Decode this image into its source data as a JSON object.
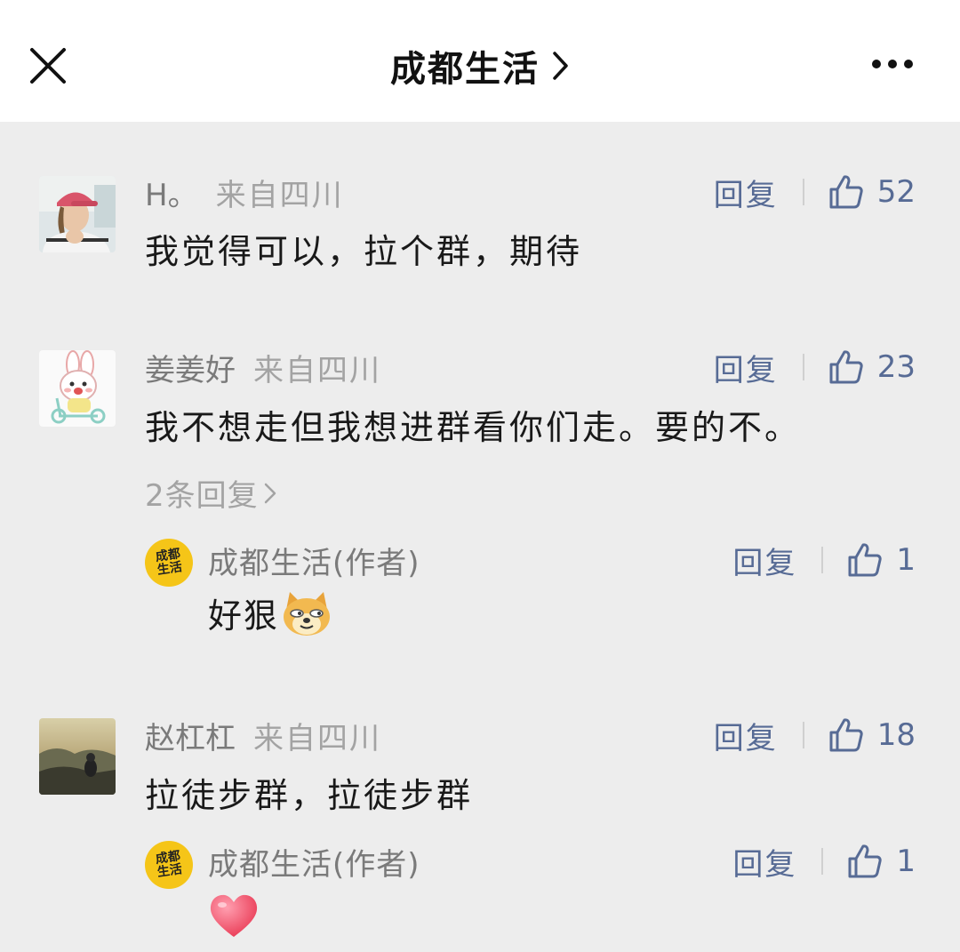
{
  "header": {
    "title": "成都生活",
    "close_icon": "close-icon",
    "more_icon": "more-dots-icon"
  },
  "comments": [
    {
      "nickname": "H。",
      "location": "来自四川",
      "content": "我觉得可以，拉个群，期待",
      "reply_label": "回复",
      "likes": "52"
    },
    {
      "nickname": "姜姜好",
      "location": "来自四川",
      "content": "我不想走但我想进群看你们走。要的不。",
      "reply_label": "回复",
      "likes": "23",
      "more_replies": "2条回复",
      "author_reply": {
        "avatar_text": "成都生活",
        "name": "成都生活(作者)",
        "content": "好狠",
        "emoji": "doge-emoji",
        "reply_label": "回复",
        "likes": "1"
      }
    },
    {
      "nickname": "赵杠杠",
      "location": "来自四川",
      "content": "拉徒步群，拉徒步群",
      "reply_label": "回复",
      "likes": "18",
      "author_reply": {
        "avatar_text": "成都生活",
        "name": "成都生活(作者)",
        "content": "",
        "emoji": "heart-emoji",
        "reply_label": "回复",
        "likes": "1"
      }
    }
  ],
  "colors": {
    "link": "#576b95",
    "background": "#ededed",
    "muted": "#a3a3a3",
    "nickname": "#7a7a7a"
  }
}
